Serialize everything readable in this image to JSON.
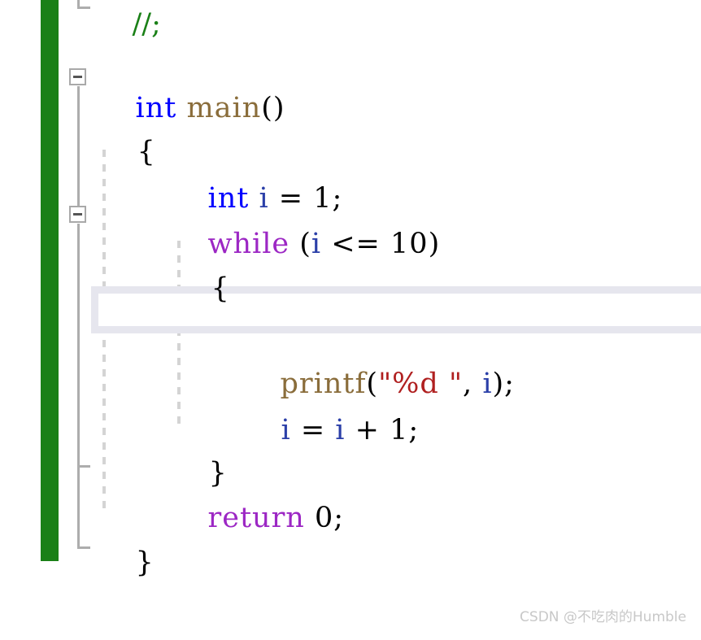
{
  "editor": {
    "language": "c",
    "background_color": "#ffffff",
    "change_bar_color": "#1a8017",
    "current_line_highlight_color": "#e6e6ee",
    "indent_guide_color": "#d4d4d4",
    "outline_color": "#adadad"
  },
  "colors": {
    "keyword_type": "#0000ff",
    "keyword_control": "#9c27c4",
    "function": "#8a6d3b",
    "string": "#b02020",
    "variable": "#2b3fa8",
    "comment": "#1a8017",
    "punctuation": "#000000"
  },
  "gutter": {
    "fold_markers": [
      {
        "name": "fold-main",
        "state": "expanded",
        "glyph": "minus"
      },
      {
        "name": "fold-while",
        "state": "expanded",
        "glyph": "minus"
      }
    ]
  },
  "code": {
    "clipped_top_line": "//;",
    "lines": [
      {
        "id": "line-main-signature",
        "indent": 0,
        "text": "int main()",
        "tokens": [
          {
            "t": "int",
            "c": "kw-type"
          },
          {
            "t": " ",
            "c": "punct"
          },
          {
            "t": "main",
            "c": "func"
          },
          {
            "t": "()",
            "c": "punct"
          }
        ]
      },
      {
        "id": "line-open-brace-main",
        "indent": 0,
        "text": "{",
        "tokens": [
          {
            "t": "{",
            "c": "punct"
          }
        ]
      },
      {
        "id": "line-decl-i",
        "indent": 1,
        "text": "int i = 1;",
        "tokens": [
          {
            "t": "int",
            "c": "kw-type"
          },
          {
            "t": " ",
            "c": "punct"
          },
          {
            "t": "i",
            "c": "var"
          },
          {
            "t": " = ",
            "c": "punct"
          },
          {
            "t": "1",
            "c": "num"
          },
          {
            "t": ";",
            "c": "punct"
          }
        ]
      },
      {
        "id": "line-while",
        "indent": 1,
        "text": "while (i <= 10)",
        "tokens": [
          {
            "t": "while",
            "c": "kw-ctrl"
          },
          {
            "t": " (",
            "c": "punct"
          },
          {
            "t": "i",
            "c": "var"
          },
          {
            "t": " <= ",
            "c": "punct"
          },
          {
            "t": "10",
            "c": "num"
          },
          {
            "t": ")",
            "c": "punct"
          }
        ]
      },
      {
        "id": "line-open-brace-while",
        "indent": 1,
        "text": "{",
        "tokens": [
          {
            "t": "{",
            "c": "punct"
          }
        ]
      },
      {
        "id": "line-empty-current",
        "indent": 2,
        "text": "",
        "current": true,
        "tokens": []
      },
      {
        "id": "line-printf",
        "indent": 2,
        "text": "printf(\"%d \", i);",
        "tokens": [
          {
            "t": "printf",
            "c": "func"
          },
          {
            "t": "(",
            "c": "punct"
          },
          {
            "t": "\"%d \"",
            "c": "string"
          },
          {
            "t": ", ",
            "c": "punct"
          },
          {
            "t": "i",
            "c": "var"
          },
          {
            "t": ");",
            "c": "punct"
          }
        ]
      },
      {
        "id": "line-increment",
        "indent": 2,
        "text": "i = i + 1;",
        "tokens": [
          {
            "t": "i",
            "c": "var"
          },
          {
            "t": " = ",
            "c": "punct"
          },
          {
            "t": "i",
            "c": "var"
          },
          {
            "t": " + ",
            "c": "punct"
          },
          {
            "t": "1",
            "c": "num"
          },
          {
            "t": ";",
            "c": "punct"
          }
        ]
      },
      {
        "id": "line-close-brace-while",
        "indent": 1,
        "text": "}",
        "tokens": [
          {
            "t": "}",
            "c": "punct"
          }
        ]
      },
      {
        "id": "line-return",
        "indent": 1,
        "text": "return 0;",
        "tokens": [
          {
            "t": "return",
            "c": "kw-ctrl"
          },
          {
            "t": " ",
            "c": "punct"
          },
          {
            "t": "0",
            "c": "num"
          },
          {
            "t": ";",
            "c": "punct"
          }
        ]
      },
      {
        "id": "line-close-brace-main",
        "indent": 0,
        "text": "}",
        "tokens": [
          {
            "t": "}",
            "c": "punct"
          }
        ]
      }
    ]
  },
  "watermark": {
    "text": "CSDN @不吃肉的Humble"
  }
}
